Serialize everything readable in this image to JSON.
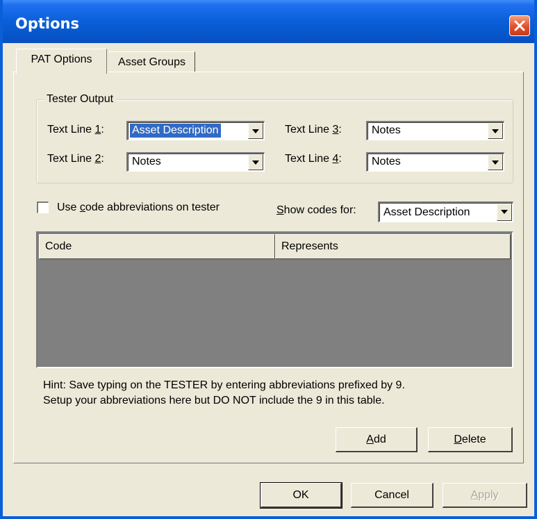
{
  "window": {
    "title": "Options",
    "close_icon": "close-icon",
    "accent_color": "#0a5fd8"
  },
  "tabs": [
    {
      "label": "PAT Options",
      "active": true
    },
    {
      "label": "Asset Groups",
      "active": false
    }
  ],
  "tester_output": {
    "legend": "Tester Output",
    "lines": [
      {
        "label_pre": "Text Line ",
        "label_key": "1",
        "label_post": ":",
        "value": "Asset Description"
      },
      {
        "label_pre": "Text Line ",
        "label_key": "2",
        "label_post": ":",
        "value": "Notes"
      },
      {
        "label_pre": "Text Line ",
        "label_key": "3",
        "label_post": ":",
        "value": "Notes"
      },
      {
        "label_pre": "Text Line ",
        "label_key": "4",
        "label_post": ":",
        "value": "Notes"
      }
    ]
  },
  "abbreviations": {
    "checkbox_pre": "Use ",
    "checkbox_key": "c",
    "checkbox_post": "ode abbreviations on tester",
    "checked": false,
    "show_codes_key": "S",
    "show_codes_post": "how codes for:",
    "show_codes_value": "Asset Description"
  },
  "grid": {
    "columns": [
      "Code",
      "Represents"
    ],
    "rows": []
  },
  "hint": {
    "line1": "Hint: Save typing on the TESTER by entering abbreviations prefixed by 9.",
    "line2": "Setup your abbreviations here but DO NOT include the 9 in this table."
  },
  "buttons": {
    "add_key": "A",
    "add_post": "dd",
    "delete_key": "D",
    "delete_post": "elete",
    "ok": "OK",
    "cancel": "Cancel",
    "apply_key": "A",
    "apply_post": "pply"
  }
}
